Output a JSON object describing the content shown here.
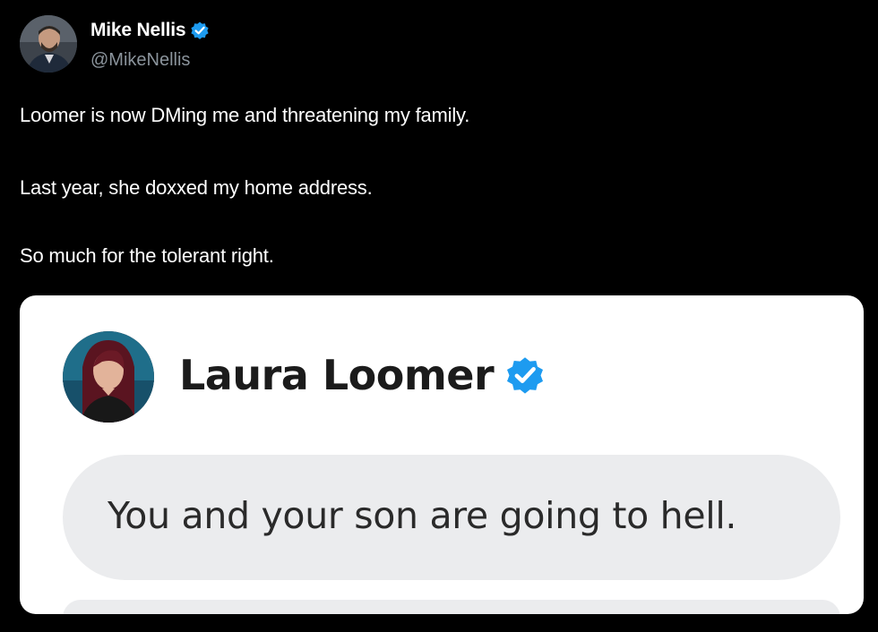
{
  "author": {
    "display_name": "Mike Nellis",
    "handle": "@MikeNellis",
    "verified_icon": "verified-badge-icon",
    "avatar_icon": "profile-photo"
  },
  "tweet": {
    "lines": [
      "Loomer is now DMing me and threatening my family.",
      "Last year, she doxxed my home address.",
      "So much for the tolerant right."
    ]
  },
  "embedded_screenshot": {
    "sender_name": "Laura Loomer",
    "verified_icon": "verified-badge-icon",
    "avatar_icon": "profile-photo",
    "message": "You and your son are going to hell."
  },
  "colors": {
    "background": "#000000",
    "verified_blue": "#1d9bf0",
    "handle_gray": "#8b949c",
    "bubble_gray": "#ebecee"
  }
}
